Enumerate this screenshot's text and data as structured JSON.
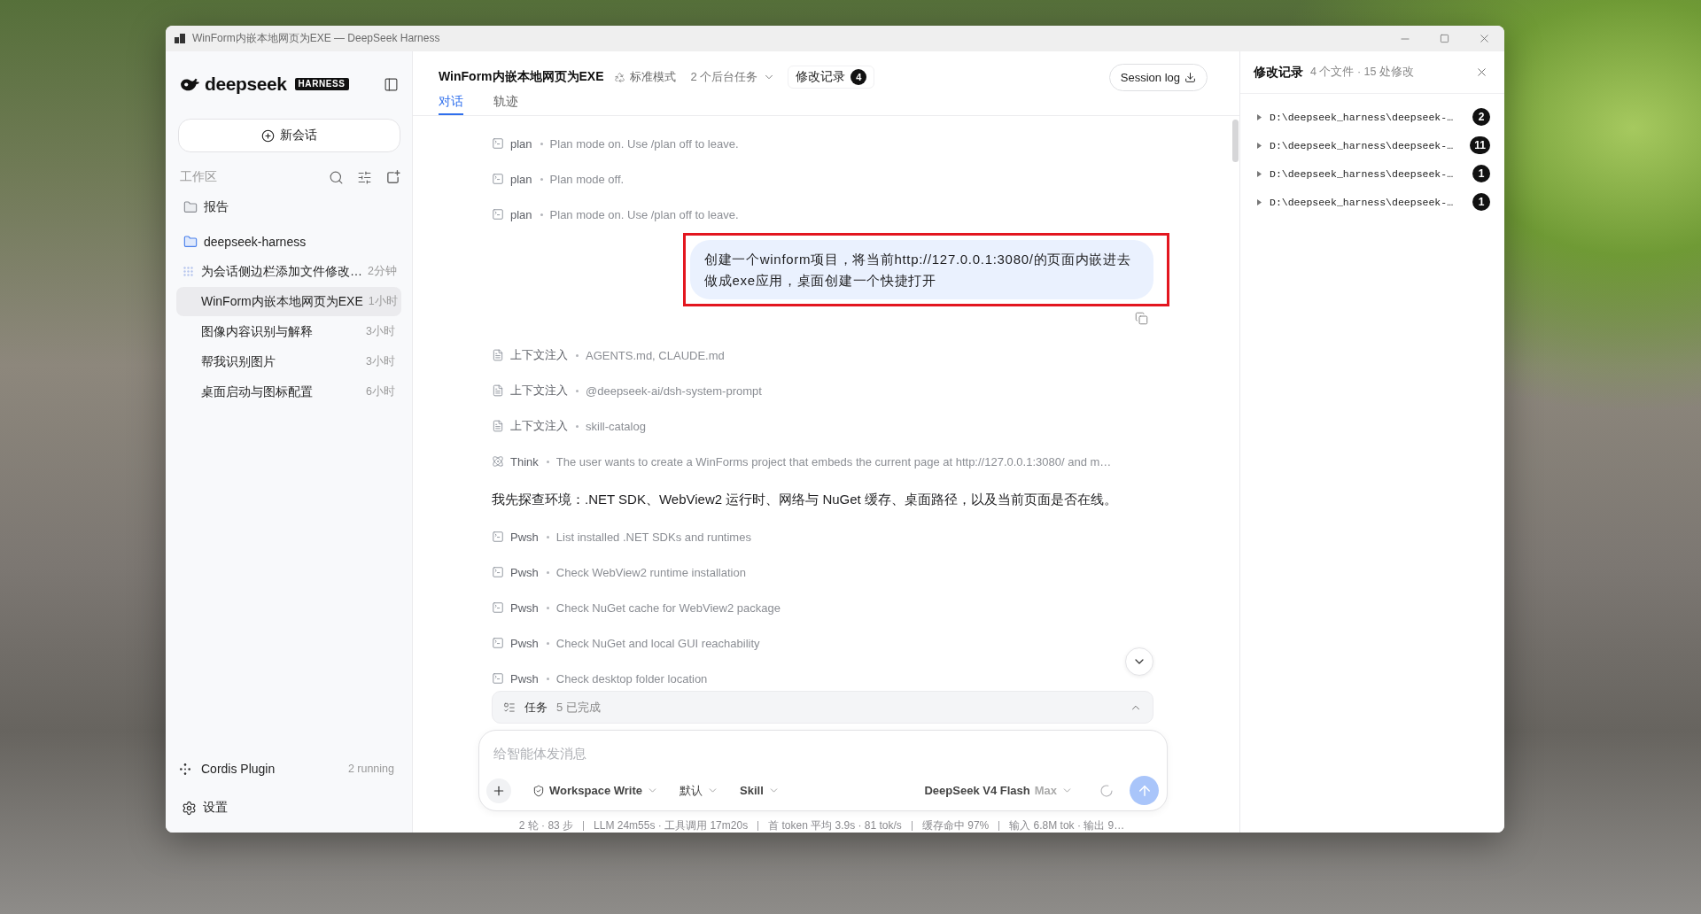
{
  "window": {
    "title": "WinForm内嵌本地网页为EXE — DeepSeek Harness"
  },
  "sidebar": {
    "logo": {
      "wordmark": "deepseek",
      "badge": "HARNESS"
    },
    "new_chat": "新会话",
    "workspace_label": "工作区",
    "folders": [
      {
        "name": "报告",
        "expanded": false
      },
      {
        "name": "deepseek-harness",
        "expanded": true,
        "sessions": [
          {
            "title": "为会话侧边栏添加文件修改…",
            "time": "2分钟",
            "selected": false,
            "running": true
          },
          {
            "title": "WinForm内嵌本地网页为EXE",
            "time": "1小时",
            "selected": true,
            "running": false
          },
          {
            "title": "图像内容识别与解释",
            "time": "3小时",
            "selected": false,
            "running": false
          },
          {
            "title": "帮我识别图片",
            "time": "3小时",
            "selected": false,
            "running": false
          },
          {
            "title": "桌面启动与图标配置",
            "time": "6小时",
            "selected": false,
            "running": false
          }
        ]
      }
    ],
    "plugin": {
      "name": "Cordis Plugin",
      "status": "2 running"
    },
    "settings": "设置"
  },
  "conversation": {
    "title": "WinForm内嵌本地网页为EXE",
    "mode": "标准模式",
    "background_tasks": "2 个后台任务",
    "changes_button": {
      "label": "修改记录",
      "count": "4"
    },
    "session_log": "Session log",
    "tabs": [
      {
        "label": "对话",
        "selected": true
      },
      {
        "label": "轨迹",
        "selected": false
      }
    ],
    "messages": [
      {
        "kind": "command",
        "tool": "plan",
        "detail": "Plan mode on. Use /plan off to leave."
      },
      {
        "kind": "command",
        "tool": "plan",
        "detail": "Plan mode off."
      },
      {
        "kind": "command",
        "tool": "plan",
        "detail": "Plan mode on. Use /plan off to leave."
      },
      {
        "kind": "user",
        "text": "创建一个winform项目，将当前http://127.0.0.1:3080/的页面内嵌进去做成exe应用，桌面创建一个快捷打开",
        "highlighted": true
      },
      {
        "kind": "context",
        "tool": "上下文注入",
        "detail": "AGENTS.md, CLAUDE.md"
      },
      {
        "kind": "context",
        "tool": "上下文注入",
        "detail": "@deepseek-ai/dsh-system-prompt"
      },
      {
        "kind": "context",
        "tool": "上下文注入",
        "detail": "skill-catalog"
      },
      {
        "kind": "think",
        "tool": "Think",
        "detail": "The user wants to create a WinForms project that embeds the current page at http://127.0.0.1:3080/ and m…"
      },
      {
        "kind": "reply",
        "text": "我先探查环境：.NET SDK、WebView2 运行时、网络与 NuGet 缓存、桌面路径，以及当前页面是否在线。"
      },
      {
        "kind": "command",
        "tool": "Pwsh",
        "detail": "List installed .NET SDKs and runtimes"
      },
      {
        "kind": "command",
        "tool": "Pwsh",
        "detail": "Check WebView2 runtime installation"
      },
      {
        "kind": "command",
        "tool": "Pwsh",
        "detail": "Check NuGet cache for WebView2 package"
      },
      {
        "kind": "command",
        "tool": "Pwsh",
        "detail": "Check NuGet and local GUI reachability"
      },
      {
        "kind": "command",
        "tool": "Pwsh",
        "detail": "Check desktop folder location"
      }
    ],
    "tasks": {
      "label": "任务",
      "summary": "5 已完成"
    },
    "composer": {
      "placeholder": "给智能体发消息",
      "permission": "Workspace Write",
      "mode": "默认",
      "skill": "Skill",
      "model": "DeepSeek V4 Flash",
      "effort": "Max",
      "send_disabled": true
    },
    "status": [
      "2 轮 · 83 步",
      "LLM 24m55s · 工具调用 17m20s",
      "首 token 平均 3.9s · 81 tok/s",
      "缓存命中 97%",
      "输入 6.8M tok · 输出 9…"
    ]
  },
  "changes_panel": {
    "title": "修改记录",
    "summary": "4 个文件 · 15 处修改",
    "files": [
      {
        "path": "D:\\deepseek_harness\\deepseek-…",
        "count": "2",
        "expanded": false
      },
      {
        "path": "D:\\deepseek_harness\\deepseek-…",
        "count": "11",
        "expanded": false
      },
      {
        "path": "D:\\deepseek_harness\\deepseek-…",
        "count": "1",
        "expanded": false
      },
      {
        "path": "D:\\deepseek_harness\\deepseek-…",
        "count": "1",
        "expanded": false
      }
    ]
  }
}
